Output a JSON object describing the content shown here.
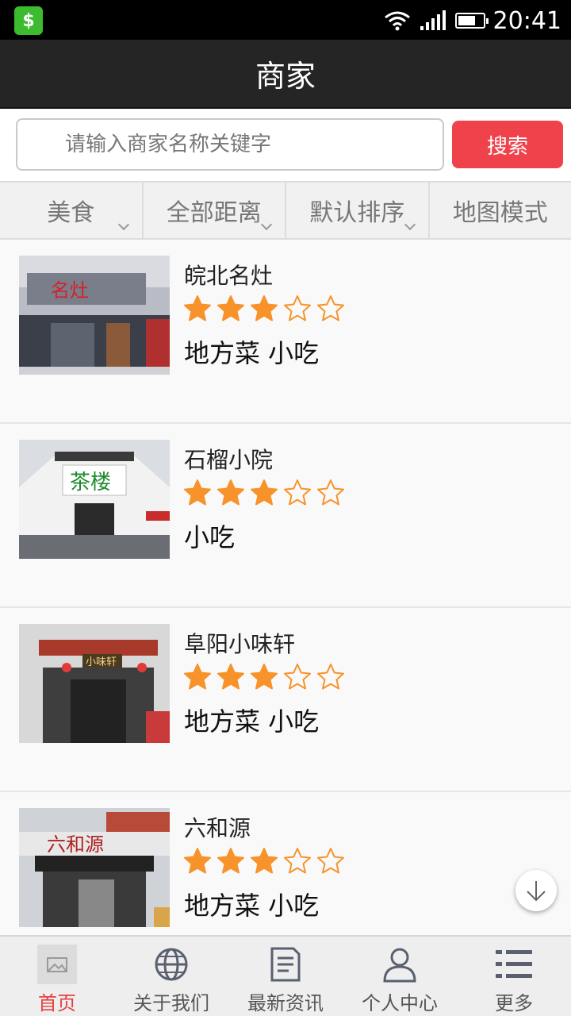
{
  "status": {
    "time": "20:41",
    "app_icon": "wallet-app-icon",
    "battery_level": 0.7
  },
  "header": {
    "title": "商家"
  },
  "search": {
    "placeholder": "请输入商家名称关键字",
    "button_label": "搜索"
  },
  "filters": [
    {
      "label": "美食",
      "has_dropdown": true
    },
    {
      "label": "全部距离",
      "has_dropdown": true
    },
    {
      "label": "默认排序",
      "has_dropdown": true
    },
    {
      "label": "地图模式",
      "has_dropdown": false
    }
  ],
  "merchants": [
    {
      "name": "皖北名灶",
      "rating": 3,
      "max_rating": 5,
      "tags": "地方菜 小吃"
    },
    {
      "name": "石榴小院",
      "rating": 3,
      "max_rating": 5,
      "tags": "小吃"
    },
    {
      "name": "阜阳小味轩",
      "rating": 3,
      "max_rating": 5,
      "tags": "地方菜 小吃"
    },
    {
      "name": "六和源",
      "rating": 3,
      "max_rating": 5,
      "tags": "地方菜 小吃"
    }
  ],
  "tabbar": [
    {
      "label": "首页",
      "icon": "image-icon",
      "active": true
    },
    {
      "label": "关于我们",
      "icon": "globe-icon",
      "active": false
    },
    {
      "label": "最新资讯",
      "icon": "document-icon",
      "active": false
    },
    {
      "label": "个人中心",
      "icon": "person-icon",
      "active": false
    },
    {
      "label": "更多",
      "icon": "list-icon",
      "active": false
    }
  ],
  "colors": {
    "accent": "#f0424a",
    "star": "#f7932a",
    "titlebar": "#252525"
  }
}
